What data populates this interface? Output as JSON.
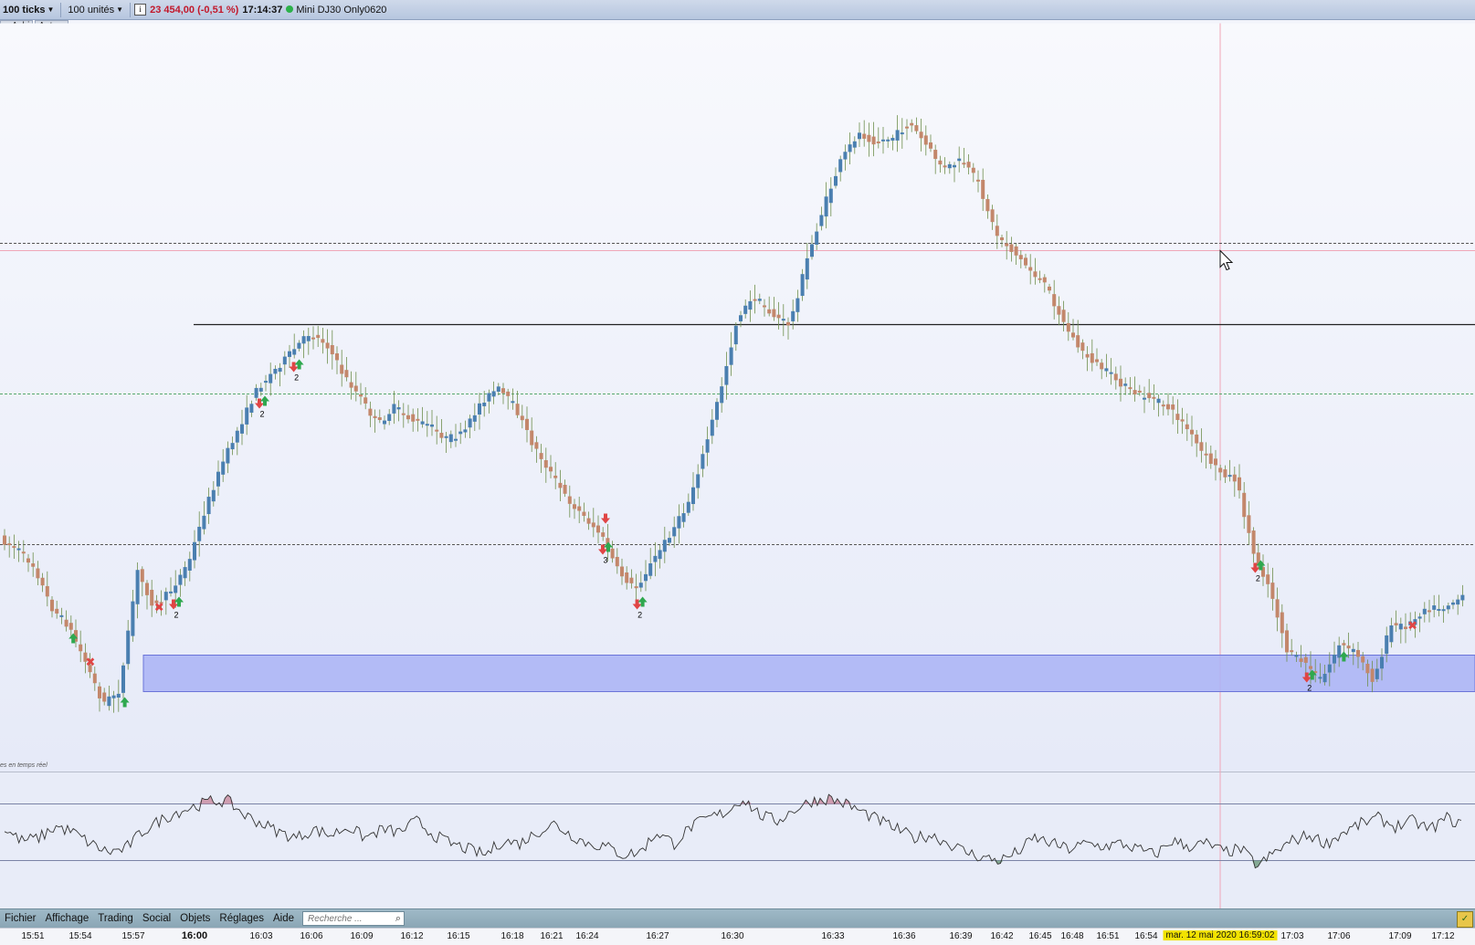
{
  "toolbar": {
    "interval": "100 ticks",
    "quantity": "100 unités",
    "info_icon": "i",
    "price": "23 454,00 (-0,51 %)",
    "time": "17:14:37",
    "instrument": "Mini DJ30 Only0620"
  },
  "subbar": {
    "tab1": "n-Ashi",
    "tab2": "Autres"
  },
  "chart": {
    "realtime_label": "es en temps réel"
  },
  "menu": {
    "items": [
      "Fichier",
      "Affichage",
      "Trading",
      "Social",
      "Objets",
      "Réglages",
      "Aide"
    ],
    "search_placeholder": "Recherche ..."
  },
  "time_axis": {
    "labels": [
      "15:51",
      "15:54",
      "15:57",
      "16:00",
      "16:03",
      "16:06",
      "16:09",
      "16:12",
      "16:15",
      "16:18",
      "16:21",
      "16:24",
      "16:27",
      "16:30",
      "16:33",
      "16:36",
      "16:39",
      "16:42",
      "16:45",
      "16:48",
      "16:51",
      "16:54",
      "17:03",
      "17:06",
      "17:09",
      "17:12"
    ],
    "bold_label": "16:00",
    "date_badge": "mar. 12 mai 2020 16:59:02"
  },
  "colors": {
    "up": "#4a7fb0",
    "down": "#c3876b",
    "zone": "#a9b3f6",
    "buy_arrow": "#2fa84f",
    "sell_arrow": "#e04545"
  },
  "icons": [
    "info-icon",
    "chevron-down-icon",
    "search-icon",
    "cursor-icon",
    "buy-arrow-icon",
    "sell-arrow-icon",
    "close-position-icon"
  ],
  "chart_data": {
    "type": "candlestick",
    "price_line": [
      565,
      575,
      595,
      640,
      660,
      700,
      745,
      730,
      600,
      640,
      620,
      590,
      530,
      480,
      440,
      400,
      380,
      360,
      340,
      350,
      385,
      410,
      440,
      420,
      435,
      440,
      455,
      450,
      415,
      400,
      420,
      460,
      490,
      520,
      540,
      560,
      600,
      620,
      590,
      560,
      530,
      470,
      400,
      320,
      300,
      320,
      330,
      260,
      200,
      150,
      120,
      130,
      125,
      110,
      135,
      160,
      150,
      175,
      230,
      250,
      270,
      290,
      330,
      360,
      375,
      390,
      405,
      410,
      420,
      440,
      470,
      490,
      500,
      580,
      620,
      690,
      700,
      720,
      680,
      690,
      720,
      660,
      660,
      640,
      640,
      630
    ],
    "signals": [
      {
        "type": "buy",
        "i": 4,
        "label": ""
      },
      {
        "type": "close",
        "i": 5,
        "label": ""
      },
      {
        "type": "buy",
        "i": 7,
        "label": ""
      },
      {
        "type": "close",
        "i": 9,
        "label": ""
      },
      {
        "type": "both",
        "i": 10,
        "label": "2"
      },
      {
        "type": "both",
        "i": 15,
        "label": "2"
      },
      {
        "type": "both",
        "i": 17,
        "label": "2"
      },
      {
        "type": "sell",
        "i": 35,
        "label": ""
      },
      {
        "type": "both",
        "i": 35,
        "label": "3"
      },
      {
        "type": "both",
        "i": 37,
        "label": "2"
      },
      {
        "type": "both",
        "i": 73,
        "label": "2"
      },
      {
        "type": "both",
        "i": 76,
        "label": "2"
      },
      {
        "type": "buy",
        "i": 78,
        "label": ""
      },
      {
        "type": "close",
        "i": 82,
        "label": ""
      }
    ],
    "oscillator": [
      0.55,
      0.35,
      0.4,
      0.6,
      0.5,
      0.3,
      0.15,
      0.2,
      0.5,
      0.7,
      0.85,
      0.95,
      1.05,
      1.05,
      0.8,
      0.65,
      0.5,
      0.4,
      0.55,
      0.45,
      0.6,
      0.4,
      0.55,
      0.5,
      0.7,
      0.45,
      0.3,
      0.2,
      0.1,
      0.35,
      0.3,
      0.5,
      0.65,
      0.45,
      0.3,
      0.25,
      0.1,
      0.15,
      0.5,
      0.3,
      0.6,
      0.75,
      0.85,
      1.1,
      0.8,
      0.7,
      0.9,
      1.05,
      1.1,
      1.0,
      0.85,
      0.7,
      0.55,
      0.4,
      0.45,
      0.3,
      0.15,
      0.05,
      0.0,
      0.15,
      0.4,
      0.3,
      0.2,
      0.3,
      0.25,
      0.3,
      0.2,
      0.1,
      0.35,
      0.25,
      0.3,
      0.15,
      0.2,
      -0.1,
      0.15,
      0.35,
      0.45,
      0.3,
      0.5,
      0.65,
      0.75,
      0.6,
      0.7,
      0.55,
      0.75,
      0.6
    ]
  }
}
